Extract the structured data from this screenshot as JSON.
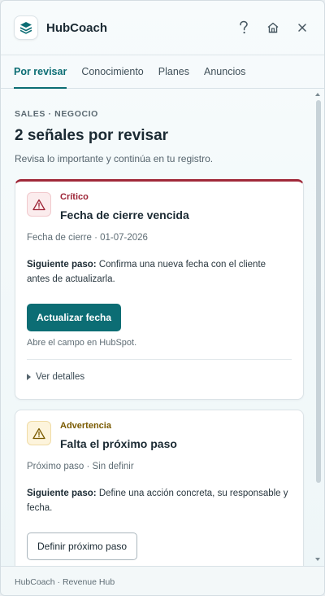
{
  "app": {
    "title": "HubCoach"
  },
  "header": {
    "help_icon": "question-icon",
    "home_icon": "home-icon",
    "close_icon": "close-icon"
  },
  "tabs": [
    {
      "label": "Por revisar",
      "active": true
    },
    {
      "label": "Conocimiento",
      "active": false
    },
    {
      "label": "Planes",
      "active": false
    },
    {
      "label": "Anuncios",
      "active": false
    }
  ],
  "main": {
    "eyebrow": "SALES · NEGOCIO",
    "title": "2 señales por revisar",
    "subtitle": "Revisa lo importante y continúa en tu registro."
  },
  "cards": [
    {
      "severity": "Crítico",
      "title": "Fecha de cierre vencida",
      "meta": "Fecha de cierre · 01-07-2026",
      "step_label": "Siguiente paso:",
      "step_text": " Confirma una nueva fecha con el cliente antes de actualizarla.",
      "button": "Actualizar fecha",
      "hint": "Abre el campo en HubSpot.",
      "details": "Ver detalles",
      "accent": "#a0293a",
      "icon": "warning-icon"
    },
    {
      "severity": "Advertencia",
      "title": "Falta el próximo paso",
      "meta": "Próximo paso · Sin definir",
      "step_label": "Siguiente paso:",
      "step_text": " Define una acción concreta, su responsable y fecha.",
      "button": "Definir próximo paso",
      "icon": "warning-icon"
    }
  ],
  "footer": {
    "text": "HubCoach · Revenue Hub"
  },
  "colors": {
    "primary": "#0c6d74",
    "critical": "#9c2235",
    "warning": "#7a5a00"
  }
}
